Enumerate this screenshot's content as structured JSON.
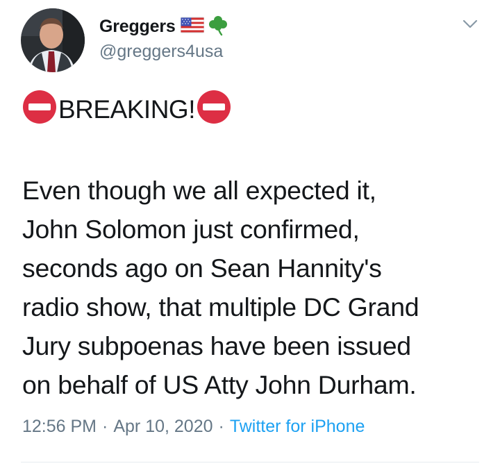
{
  "user": {
    "display_name": "Greggers",
    "handle": "@greggers4usa",
    "name_emojis": [
      "us-flag-icon",
      "shamrock-icon"
    ]
  },
  "tweet": {
    "headline": "BREAKING!",
    "body_lines": [
      "Even though we all expected it,",
      "John Solomon just confirmed,",
      "seconds ago on Sean Hannity's",
      "radio show, that multiple DC Grand",
      "Jury subpoenas have been issued",
      "on behalf of US Atty John Durham."
    ]
  },
  "meta": {
    "time": "12:56 PM",
    "separator": "·",
    "date": "Apr 10, 2020",
    "source": "Twitter for iPhone"
  },
  "colors": {
    "text": "#14171a",
    "secondary": "#657786",
    "link": "#1da1f2",
    "stop_red": "#dd2e44",
    "divider": "#e6ecf0"
  }
}
